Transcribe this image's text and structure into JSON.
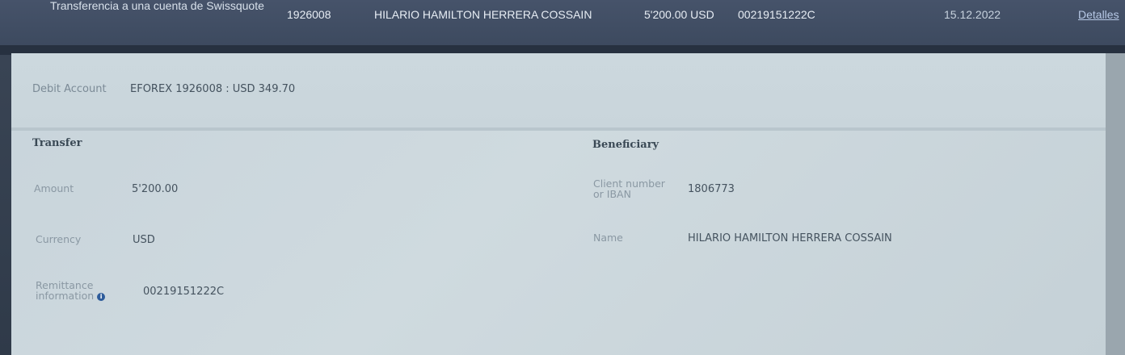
{
  "transaction": {
    "type": "Transferencia a una cuenta de Swissquote",
    "account": "1926008",
    "beneficiary_name": "HILARIO HAMILTON HERRERA COSSAIN",
    "amount": "5'200.00 USD",
    "reference": "00219151222C",
    "date": "15.12.2022",
    "details_link": "Detalles"
  },
  "debit": {
    "label": "Debit Account",
    "value": "EFOREX 1926008 : USD 349.70"
  },
  "transfer": {
    "title": "Transfer",
    "amount_label": "Amount",
    "amount_value": "5'200.00",
    "currency_label": "Currency",
    "currency_value": "USD",
    "remittance_label": "Remittance information",
    "remittance_value": "00219151222C",
    "info_icon": "info-icon"
  },
  "beneficiary": {
    "title": "Beneficiary",
    "client_label": "Client number or IBAN",
    "client_value": "1806773",
    "name_label": "Name",
    "name_value": "HILARIO HAMILTON HERRERA COSSAIN"
  }
}
